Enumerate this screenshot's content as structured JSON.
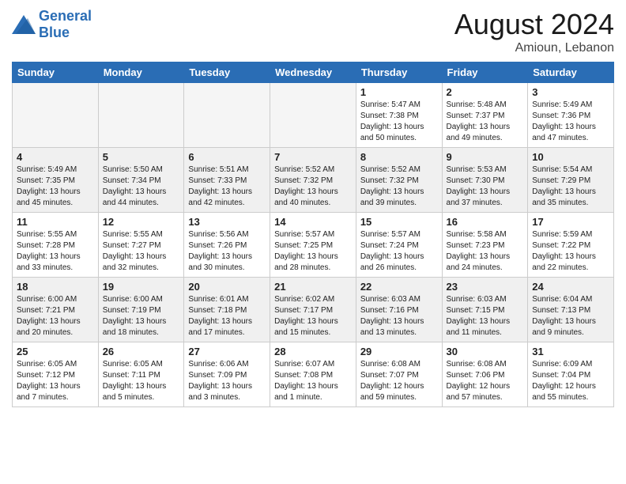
{
  "header": {
    "logo_line1": "General",
    "logo_line2": "Blue",
    "month_title": "August 2024",
    "location": "Amioun, Lebanon"
  },
  "weekdays": [
    "Sunday",
    "Monday",
    "Tuesday",
    "Wednesday",
    "Thursday",
    "Friday",
    "Saturday"
  ],
  "weeks": [
    [
      {
        "day": "",
        "info": "",
        "empty": true
      },
      {
        "day": "",
        "info": "",
        "empty": true
      },
      {
        "day": "",
        "info": "",
        "empty": true
      },
      {
        "day": "",
        "info": "",
        "empty": true
      },
      {
        "day": "1",
        "info": "Sunrise: 5:47 AM\nSunset: 7:38 PM\nDaylight: 13 hours\nand 50 minutes."
      },
      {
        "day": "2",
        "info": "Sunrise: 5:48 AM\nSunset: 7:37 PM\nDaylight: 13 hours\nand 49 minutes."
      },
      {
        "day": "3",
        "info": "Sunrise: 5:49 AM\nSunset: 7:36 PM\nDaylight: 13 hours\nand 47 minutes."
      }
    ],
    [
      {
        "day": "4",
        "info": "Sunrise: 5:49 AM\nSunset: 7:35 PM\nDaylight: 13 hours\nand 45 minutes."
      },
      {
        "day": "5",
        "info": "Sunrise: 5:50 AM\nSunset: 7:34 PM\nDaylight: 13 hours\nand 44 minutes."
      },
      {
        "day": "6",
        "info": "Sunrise: 5:51 AM\nSunset: 7:33 PM\nDaylight: 13 hours\nand 42 minutes."
      },
      {
        "day": "7",
        "info": "Sunrise: 5:52 AM\nSunset: 7:32 PM\nDaylight: 13 hours\nand 40 minutes."
      },
      {
        "day": "8",
        "info": "Sunrise: 5:52 AM\nSunset: 7:32 PM\nDaylight: 13 hours\nand 39 minutes."
      },
      {
        "day": "9",
        "info": "Sunrise: 5:53 AM\nSunset: 7:30 PM\nDaylight: 13 hours\nand 37 minutes."
      },
      {
        "day": "10",
        "info": "Sunrise: 5:54 AM\nSunset: 7:29 PM\nDaylight: 13 hours\nand 35 minutes."
      }
    ],
    [
      {
        "day": "11",
        "info": "Sunrise: 5:55 AM\nSunset: 7:28 PM\nDaylight: 13 hours\nand 33 minutes."
      },
      {
        "day": "12",
        "info": "Sunrise: 5:55 AM\nSunset: 7:27 PM\nDaylight: 13 hours\nand 32 minutes."
      },
      {
        "day": "13",
        "info": "Sunrise: 5:56 AM\nSunset: 7:26 PM\nDaylight: 13 hours\nand 30 minutes."
      },
      {
        "day": "14",
        "info": "Sunrise: 5:57 AM\nSunset: 7:25 PM\nDaylight: 13 hours\nand 28 minutes."
      },
      {
        "day": "15",
        "info": "Sunrise: 5:57 AM\nSunset: 7:24 PM\nDaylight: 13 hours\nand 26 minutes."
      },
      {
        "day": "16",
        "info": "Sunrise: 5:58 AM\nSunset: 7:23 PM\nDaylight: 13 hours\nand 24 minutes."
      },
      {
        "day": "17",
        "info": "Sunrise: 5:59 AM\nSunset: 7:22 PM\nDaylight: 13 hours\nand 22 minutes."
      }
    ],
    [
      {
        "day": "18",
        "info": "Sunrise: 6:00 AM\nSunset: 7:21 PM\nDaylight: 13 hours\nand 20 minutes."
      },
      {
        "day": "19",
        "info": "Sunrise: 6:00 AM\nSunset: 7:19 PM\nDaylight: 13 hours\nand 18 minutes."
      },
      {
        "day": "20",
        "info": "Sunrise: 6:01 AM\nSunset: 7:18 PM\nDaylight: 13 hours\nand 17 minutes."
      },
      {
        "day": "21",
        "info": "Sunrise: 6:02 AM\nSunset: 7:17 PM\nDaylight: 13 hours\nand 15 minutes."
      },
      {
        "day": "22",
        "info": "Sunrise: 6:03 AM\nSunset: 7:16 PM\nDaylight: 13 hours\nand 13 minutes."
      },
      {
        "day": "23",
        "info": "Sunrise: 6:03 AM\nSunset: 7:15 PM\nDaylight: 13 hours\nand 11 minutes."
      },
      {
        "day": "24",
        "info": "Sunrise: 6:04 AM\nSunset: 7:13 PM\nDaylight: 13 hours\nand 9 minutes."
      }
    ],
    [
      {
        "day": "25",
        "info": "Sunrise: 6:05 AM\nSunset: 7:12 PM\nDaylight: 13 hours\nand 7 minutes."
      },
      {
        "day": "26",
        "info": "Sunrise: 6:05 AM\nSunset: 7:11 PM\nDaylight: 13 hours\nand 5 minutes."
      },
      {
        "day": "27",
        "info": "Sunrise: 6:06 AM\nSunset: 7:09 PM\nDaylight: 13 hours\nand 3 minutes."
      },
      {
        "day": "28",
        "info": "Sunrise: 6:07 AM\nSunset: 7:08 PM\nDaylight: 13 hours\nand 1 minute."
      },
      {
        "day": "29",
        "info": "Sunrise: 6:08 AM\nSunset: 7:07 PM\nDaylight: 12 hours\nand 59 minutes."
      },
      {
        "day": "30",
        "info": "Sunrise: 6:08 AM\nSunset: 7:06 PM\nDaylight: 12 hours\nand 57 minutes."
      },
      {
        "day": "31",
        "info": "Sunrise: 6:09 AM\nSunset: 7:04 PM\nDaylight: 12 hours\nand 55 minutes."
      }
    ]
  ]
}
